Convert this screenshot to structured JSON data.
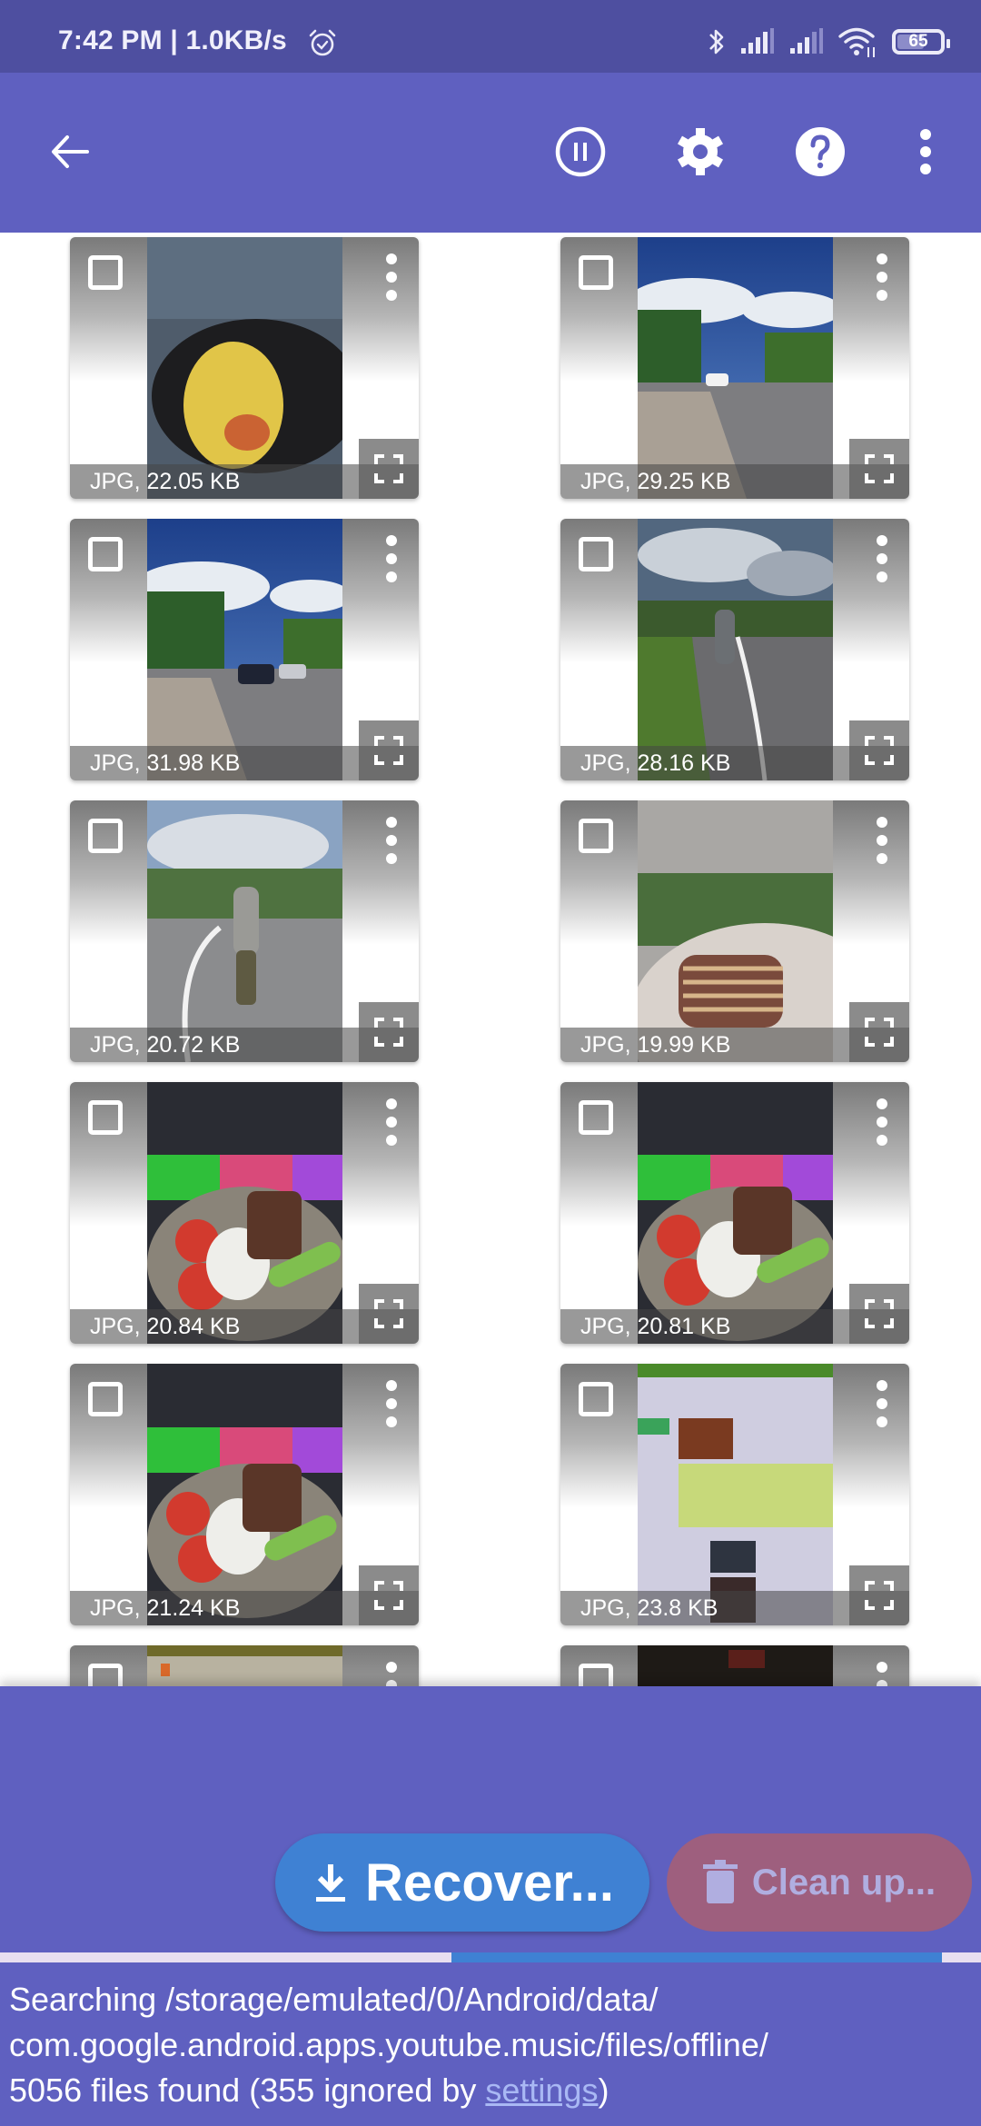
{
  "status_bar": {
    "time": "7:42 PM | 1.0KB/s",
    "battery_level": "65",
    "battery_fraction": 0.65,
    "icons": [
      "alarm-icon",
      "bluetooth-icon",
      "signal-icon",
      "signal-icon",
      "wifi-icon",
      "battery-icon"
    ]
  },
  "app_bar": {
    "icons": [
      "back-arrow-icon",
      "pause-icon",
      "gear-icon",
      "help-icon",
      "more-vert-icon"
    ]
  },
  "files": [
    {
      "label": "JPG, 22.05 KB",
      "scene": "omelette-in-pan"
    },
    {
      "label": "JPG, 29.25 KB",
      "scene": "road-with-car"
    },
    {
      "label": "JPG, 31.98 KB",
      "scene": "road-with-cars"
    },
    {
      "label": "JPG, 28.16 KB",
      "scene": "man-walking-path"
    },
    {
      "label": "JPG, 20.72 KB",
      "scene": "man-walking-path"
    },
    {
      "label": "JPG, 19.99 KB",
      "scene": "grilled-steak-plate"
    },
    {
      "label": "JPG, 20.84 KB",
      "scene": "plate-keyboard"
    },
    {
      "label": "JPG, 20.81 KB",
      "scene": "plate-keyboard"
    },
    {
      "label": "JPG, 21.24 KB",
      "scene": "plate-keyboard"
    },
    {
      "label": "JPG, 23.8 KB",
      "scene": "blurry-webpage"
    },
    {
      "label": "",
      "scene": "partial"
    },
    {
      "label": "",
      "scene": "partial-dark"
    }
  ],
  "actions": {
    "recover_label": "Recover...",
    "cleanup_label": "Clean up..."
  },
  "progress": {
    "indeterminate": true,
    "segment_start_percent": 46,
    "segment_end_percent": 96
  },
  "status": {
    "searching_line1": "Searching /storage/emulated/0/Android/data/",
    "searching_line2": "com.google.android.apps.youtube.music/files/offline/",
    "found_prefix": "5056 files found (355 ignored by ",
    "settings_link": "settings",
    "found_suffix": ")"
  },
  "colors": {
    "status_bar": "#4e4fa0",
    "app_bar": "#5f60c0",
    "recover_button": "#3f81d3",
    "cleanup_button": "#9e5f7e",
    "progress_track": "#e8dff0",
    "link": "#a9b8f4"
  }
}
